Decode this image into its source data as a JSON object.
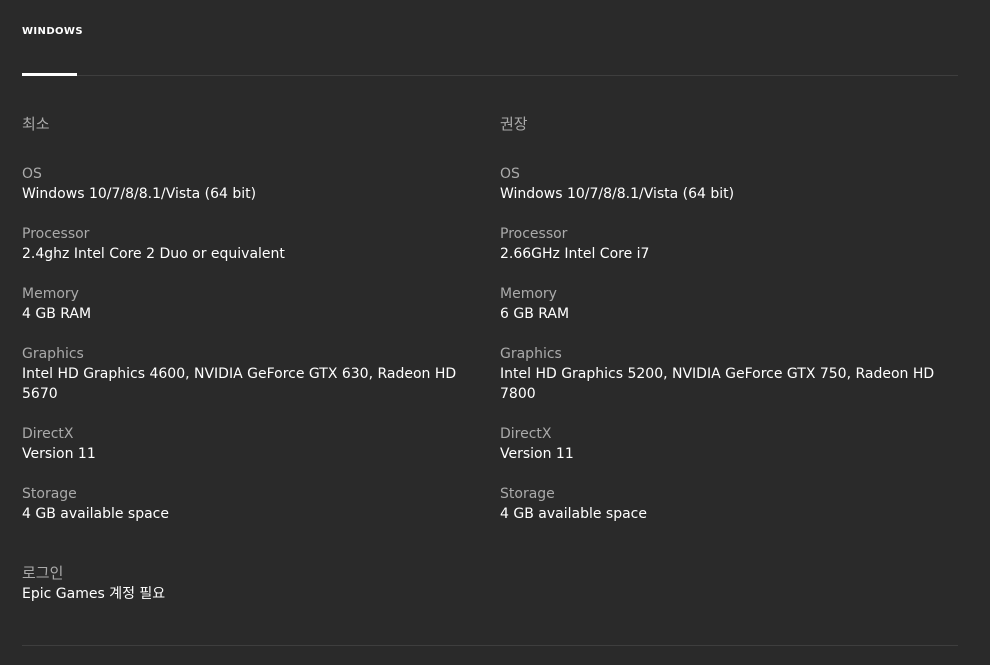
{
  "tabs": [
    {
      "label": "WINDOWS",
      "active": true
    }
  ],
  "minimum": {
    "title": "최소",
    "specs": [
      {
        "label": "OS",
        "value": "Windows 10/7/8/8.1/Vista (64 bit)"
      },
      {
        "label": "Processor",
        "value": "2.4ghz Intel Core 2 Duo or equivalent"
      },
      {
        "label": "Memory",
        "value": "4 GB RAM"
      },
      {
        "label": "Graphics",
        "value": "Intel HD Graphics 4600, NVIDIA GeForce GTX 630, Radeon HD 5670"
      },
      {
        "label": "DirectX",
        "value": "Version 11"
      },
      {
        "label": "Storage",
        "value": "4 GB available space"
      }
    ]
  },
  "recommended": {
    "title": "권장",
    "specs": [
      {
        "label": "OS",
        "value": "Windows 10/7/8/8.1/Vista (64 bit)"
      },
      {
        "label": "Processor",
        "value": "2.66GHz Intel Core i7"
      },
      {
        "label": "Memory",
        "value": "6 GB RAM"
      },
      {
        "label": "Graphics",
        "value": "Intel HD Graphics 5200, NVIDIA GeForce GTX 750, Radeon HD 7800"
      },
      {
        "label": "DirectX",
        "value": "Version 11"
      },
      {
        "label": "Storage",
        "value": "4 GB available space"
      }
    ]
  },
  "login": {
    "label": "로그인",
    "value": "Epic Games 계정 필요"
  },
  "colors": {
    "background": "#2a2a2a",
    "label": "#aaaaaa",
    "value": "#ffffff",
    "divider": "#3e3e3e"
  }
}
